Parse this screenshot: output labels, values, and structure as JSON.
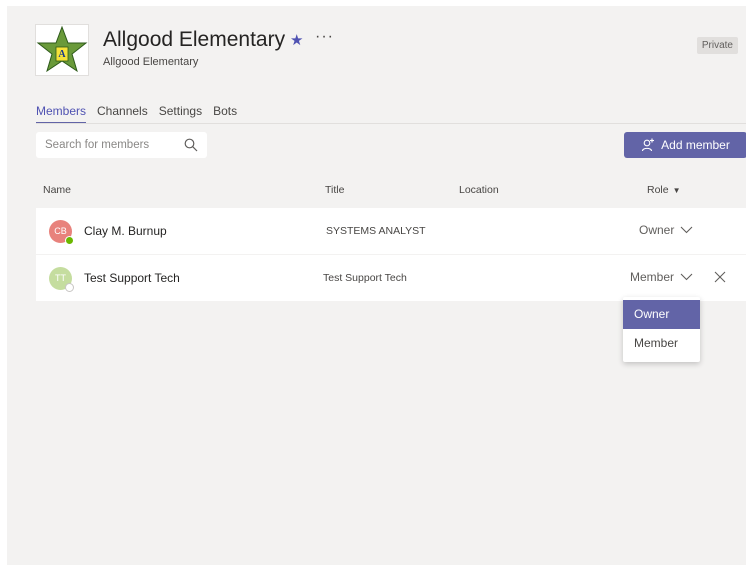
{
  "team": {
    "name": "Allgood Elementary",
    "subtitle": "Allgood Elementary",
    "privacy_badge": "Private",
    "logo_letter": "A"
  },
  "tabs": [
    {
      "label": "Members",
      "active": true
    },
    {
      "label": "Channels",
      "active": false
    },
    {
      "label": "Settings",
      "active": false
    },
    {
      "label": "Bots",
      "active": false
    }
  ],
  "search": {
    "placeholder": "Search for members"
  },
  "add_member": {
    "label": "Add member"
  },
  "columns": {
    "name": "Name",
    "title": "Title",
    "location": "Location",
    "role": "Role"
  },
  "members": [
    {
      "initials": "CB",
      "name": "Clay M. Burnup",
      "title": "SYSTEMS ANALYST",
      "location": "",
      "role": "Owner",
      "avatar_color": "#e8827c",
      "presence_color": "#6bb700"
    },
    {
      "initials": "TT",
      "name": "Test Support Tech",
      "title": "Test Support Tech",
      "location": "",
      "role": "Member",
      "avatar_color": "#c5dd9f",
      "presence_color": "#ffffff"
    }
  ],
  "role_dropdown": {
    "options": [
      "Owner",
      "Member"
    ],
    "highlighted": "Owner"
  },
  "colors": {
    "accent": "#6264a7",
    "background": "#f3f2f1"
  }
}
